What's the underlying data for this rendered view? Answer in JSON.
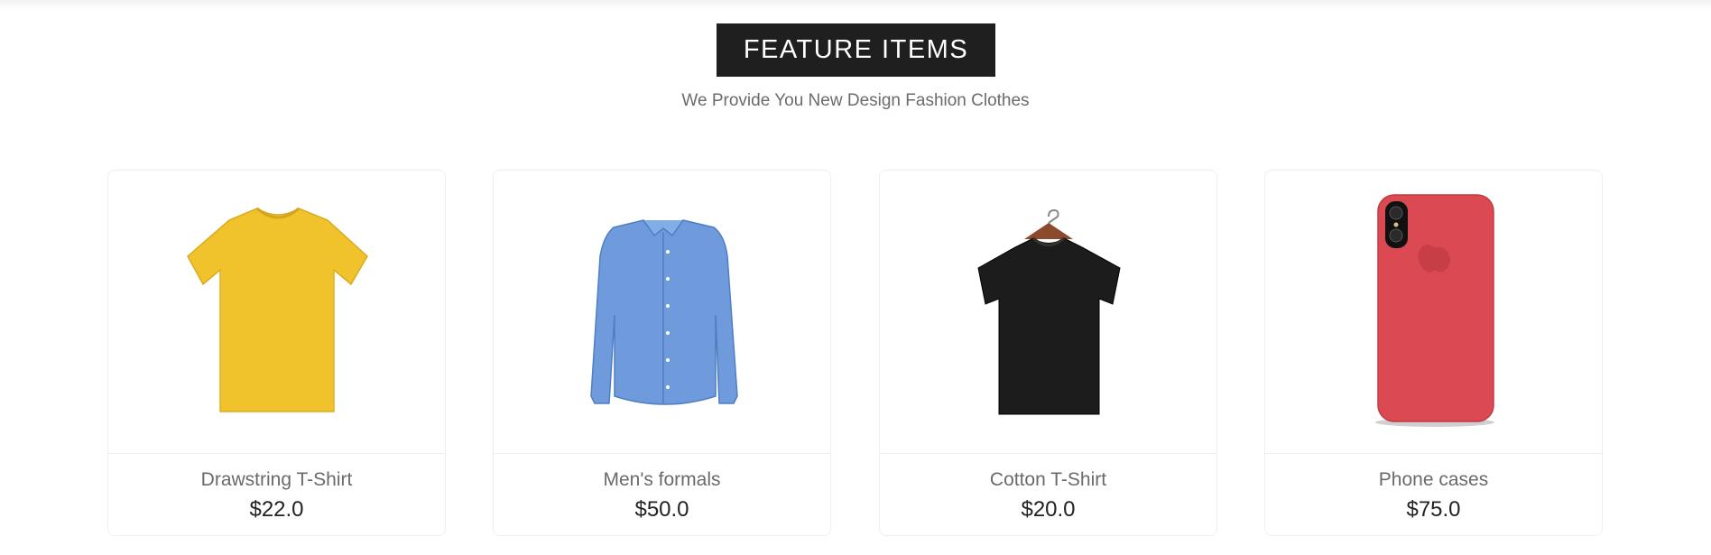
{
  "section": {
    "title": "FEATURE ITEMS",
    "subtitle": "We Provide You New Design Fashion Clothes"
  },
  "products": [
    {
      "name": "Drawstring T-Shirt",
      "price": "$22.0",
      "image": "yellow-tshirt",
      "color": "#f0c22c"
    },
    {
      "name": "Men's formals",
      "price": "$50.0",
      "image": "blue-formal-shirt",
      "color": "#6f9bdc"
    },
    {
      "name": "Cotton T-Shirt",
      "price": "$20.0",
      "image": "black-tshirt-on-hanger",
      "color": "#1c1c1c"
    },
    {
      "name": "Phone cases",
      "price": "$75.0",
      "image": "red-phone-case",
      "color": "#db4a52"
    }
  ]
}
